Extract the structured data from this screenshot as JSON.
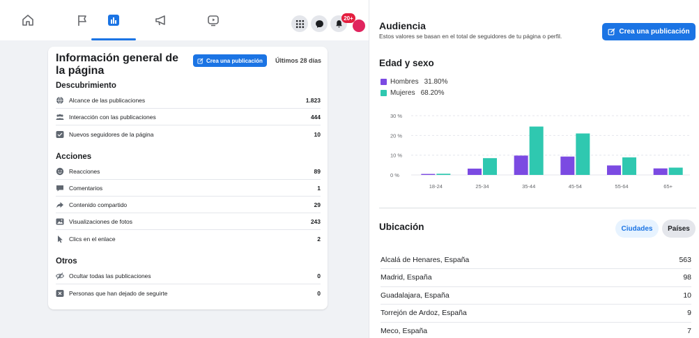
{
  "overview": {
    "title": "Información general de la página",
    "create_button": "Crea una publicación",
    "period": "Últimos 28 días",
    "sections": [
      {
        "title": "Descubrimiento",
        "rows": [
          {
            "icon": "globe-icon",
            "label": "Alcance de las publicaciones",
            "value": "1.823"
          },
          {
            "icon": "people-icon",
            "label": "Interacción con las publicaciones",
            "value": "444"
          },
          {
            "icon": "follow-icon",
            "label": "Nuevos seguidores de la página",
            "value": "10"
          }
        ]
      },
      {
        "title": "Acciones",
        "rows": [
          {
            "icon": "reaction-icon",
            "label": "Reacciones",
            "value": "89"
          },
          {
            "icon": "comment-icon",
            "label": "Comentarios",
            "value": "1"
          },
          {
            "icon": "share-icon",
            "label": "Contenido compartido",
            "value": "29"
          },
          {
            "icon": "photo-icon",
            "label": "Visualizaciones de fotos",
            "value": "243"
          },
          {
            "icon": "cursor-icon",
            "label": "Clics en el enlace",
            "value": "2"
          }
        ]
      },
      {
        "title": "Otros",
        "rows": [
          {
            "icon": "hide-icon",
            "label": "Ocultar todas las publicaciones",
            "value": "0"
          },
          {
            "icon": "unfollow-icon",
            "label": "Personas que han dejado de seguirte",
            "value": "0"
          }
        ]
      }
    ]
  },
  "nav": {
    "notification_badge": "20+"
  },
  "audience": {
    "title": "Audiencia",
    "subtitle": "Estos valores se basan en el total de seguidores de tu página o perfil.",
    "create_button": "Crea una publicación",
    "age_title": "Edad y sexo",
    "legend": [
      {
        "name": "Hombres",
        "value": "31.80%",
        "color": "#7b4ae2"
      },
      {
        "name": "Mujeres",
        "value": "68.20%",
        "color": "#2fc8b0"
      }
    ]
  },
  "chart_data": {
    "type": "bar",
    "categories": [
      "18-24",
      "25-34",
      "35-44",
      "45-54",
      "55-64",
      "65+"
    ],
    "series": [
      {
        "name": "Hombres",
        "values": [
          0.5,
          3.2,
          9.8,
          9.3,
          4.8,
          3.3
        ],
        "color": "#7b4ae2"
      },
      {
        "name": "Mujeres",
        "values": [
          0.6,
          8.5,
          24.5,
          21.0,
          8.9,
          3.7
        ],
        "color": "#2fc8b0"
      }
    ],
    "yticks": [
      "0 %",
      "10 %",
      "20 %",
      "30 %"
    ],
    "ylim": [
      0,
      30
    ],
    "grid": true,
    "legend": "top-left"
  },
  "location": {
    "title": "Ubicación",
    "tabs": {
      "cities": "Ciudades",
      "countries": "Países"
    },
    "rows": [
      {
        "name": "Alcalá de Henares, España",
        "value": "563"
      },
      {
        "name": "Madrid, España",
        "value": "98"
      },
      {
        "name": "Guadalajara, España",
        "value": "10"
      },
      {
        "name": "Torrejón de Ardoz, España",
        "value": "9"
      },
      {
        "name": "Meco, España",
        "value": "7"
      }
    ]
  }
}
